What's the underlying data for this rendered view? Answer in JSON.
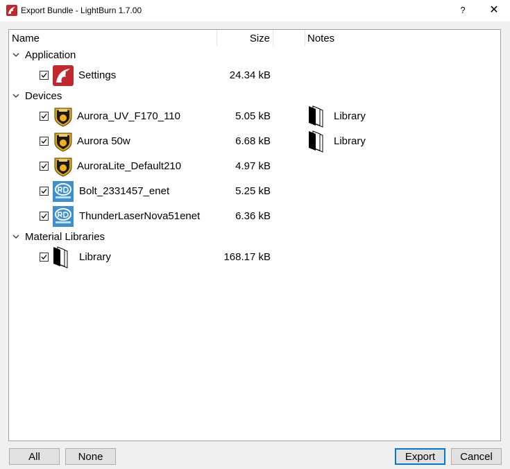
{
  "window": {
    "title": "Export Bundle - LightBurn 1.7.00",
    "help_label": "?",
    "close_label": "✕"
  },
  "tree": {
    "columns": {
      "name": "Name",
      "size": "Size",
      "notes": "Notes"
    },
    "groups": [
      {
        "label": "Application",
        "items": [
          {
            "label": "Settings",
            "size": "24.34 kB",
            "icon": "lightburn-dragon-icon",
            "checked": true,
            "note": ""
          }
        ]
      },
      {
        "label": "Devices",
        "items": [
          {
            "label": "Aurora_UV_F170_110",
            "size": "5.05 kB",
            "icon": "jcz-controller-icon",
            "checked": true,
            "note": "Library"
          },
          {
            "label": "Aurora 50w",
            "size": "6.68 kB",
            "icon": "jcz-controller-icon",
            "checked": true,
            "note": "Library"
          },
          {
            "label": "AuroraLite_Default210",
            "size": "4.97 kB",
            "icon": "jcz-controller-icon",
            "checked": true,
            "note": ""
          },
          {
            "label": "Bolt_2331457_enet",
            "size": "5.25 kB",
            "icon": "ruida-controller-icon",
            "checked": true,
            "note": ""
          },
          {
            "label": "ThunderLaserNova51enet",
            "size": "6.36 kB",
            "icon": "ruida-controller-icon",
            "checked": true,
            "note": ""
          }
        ]
      },
      {
        "label": "Material Libraries",
        "items": [
          {
            "label": "Library",
            "size": "168.17 kB",
            "icon": "library-pages-icon",
            "checked": true,
            "note": ""
          }
        ]
      }
    ]
  },
  "buttons": {
    "all": "All",
    "none": "None",
    "export": "Export",
    "cancel": "Cancel"
  },
  "colors": {
    "accent": "#0078d7",
    "dragon_red": "#c0282d",
    "jcz_gold": "#d9a520",
    "ruida_blue": "#3c8fd0"
  }
}
